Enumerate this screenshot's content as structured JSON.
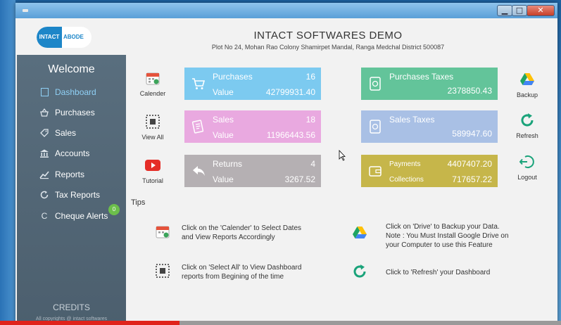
{
  "window": {
    "minimize_glyph": "▁",
    "maximize_glyph": "□",
    "close_glyph": "✕"
  },
  "header": {
    "logo_left": "INTACT",
    "logo_right": "ABODE",
    "company_name": "INTACT SOFTWARES DEMO",
    "company_address": "Plot No 24, Mohan Rao Colony Shamirpet Mandal, Ranga Medchal District 500087"
  },
  "sidebar": {
    "welcome": "Welcome",
    "items": [
      {
        "label": "Dashboard",
        "icon": "square-outline-icon"
      },
      {
        "label": "Purchases",
        "icon": "basket-icon"
      },
      {
        "label": "Sales",
        "icon": "tag-icon"
      },
      {
        "label": "Accounts",
        "icon": "bank-icon"
      },
      {
        "label": "Reports",
        "icon": "chart-icon"
      },
      {
        "label": "Tax Reports",
        "icon": "refresh-icon"
      },
      {
        "label": "Cheque Alerts",
        "icon": "c-icon"
      }
    ],
    "cheque_alerts_count": "0",
    "credits": "CREDITS",
    "copyright": "All copyrights @ intact softwares"
  },
  "actions": {
    "calender": "Calender",
    "view_all": "View All",
    "tutorial": "Tutorial",
    "backup": "Backup",
    "refresh": "Refresh",
    "logout": "Logout"
  },
  "cards": {
    "purchases": {
      "title": "Purchases",
      "count": "16",
      "sub_label": "Value",
      "value": "42799931.40"
    },
    "sales": {
      "title": "Sales",
      "count": "18",
      "sub_label": "Value",
      "value": "11966443.56"
    },
    "returns": {
      "title": "Returns",
      "count": "4",
      "sub_label": "Value",
      "value": "3267.52"
    },
    "purchases_taxes": {
      "title": "Purchases Taxes",
      "value": "2378850.43"
    },
    "sales_taxes": {
      "title": "Sales Taxes",
      "value": "589947.60"
    },
    "payments_collections": {
      "payments_label": "Payments",
      "payments_value": "4407407.20",
      "collections_label": "Collections",
      "collections_value": "717657.22"
    }
  },
  "tips": {
    "label": "Tips",
    "calender_line1": "Click on the 'Calender' to Select Dates",
    "calender_line2": "and View Reports Accordingly",
    "select_all_line1": "Click on 'Select All' to View Dashboard",
    "select_all_line2": "reports from Begining of the time",
    "drive_line1": "Click on 'Drive' to Backup your Data.",
    "drive_line2": "Note : You Must Install Google Drive on",
    "drive_line3": "your Computer to use this Feature",
    "refresh_line1": "Click to 'Refresh' your Dashboard"
  },
  "colors": {
    "purchases": "#7ccaf0",
    "sales": "#e9a9e0",
    "returns": "#b5b0b3",
    "purchases_taxes": "#63c49a",
    "sales_taxes": "#a9c0e5",
    "payments_collections": "#c6b64a",
    "sidebar": "#52677a",
    "accent": "#8fd0f5"
  },
  "video_progress": 0.32
}
